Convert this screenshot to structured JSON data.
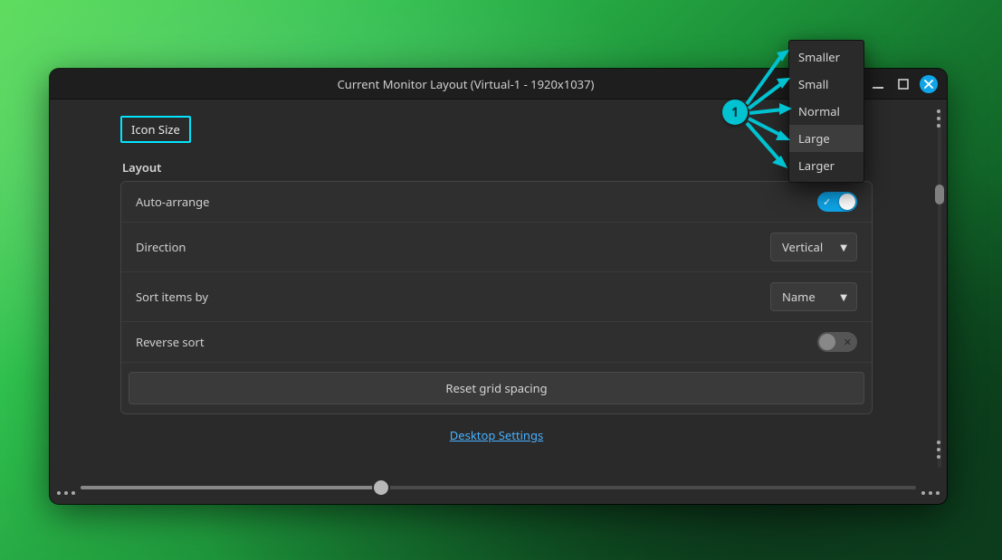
{
  "window": {
    "title": "Current Monitor Layout (Virtual-1 - 1920x1037)"
  },
  "icon_size_label": "Icon Size",
  "layout": {
    "section_title": "Layout",
    "auto_arrange": {
      "label": "Auto-arrange",
      "on": true
    },
    "direction": {
      "label": "Direction",
      "value": "Vertical"
    },
    "sort_by": {
      "label": "Sort items by",
      "value": "Name"
    },
    "reverse_sort": {
      "label": "Reverse sort",
      "on": false
    },
    "reset_label": "Reset grid spacing"
  },
  "link_label": "Desktop Settings",
  "annotation_number": "1",
  "menu": {
    "items": [
      {
        "label": "Smaller"
      },
      {
        "label": "Small"
      },
      {
        "label": "Normal"
      },
      {
        "label": "Large",
        "hover": true
      },
      {
        "label": "Larger"
      }
    ]
  }
}
